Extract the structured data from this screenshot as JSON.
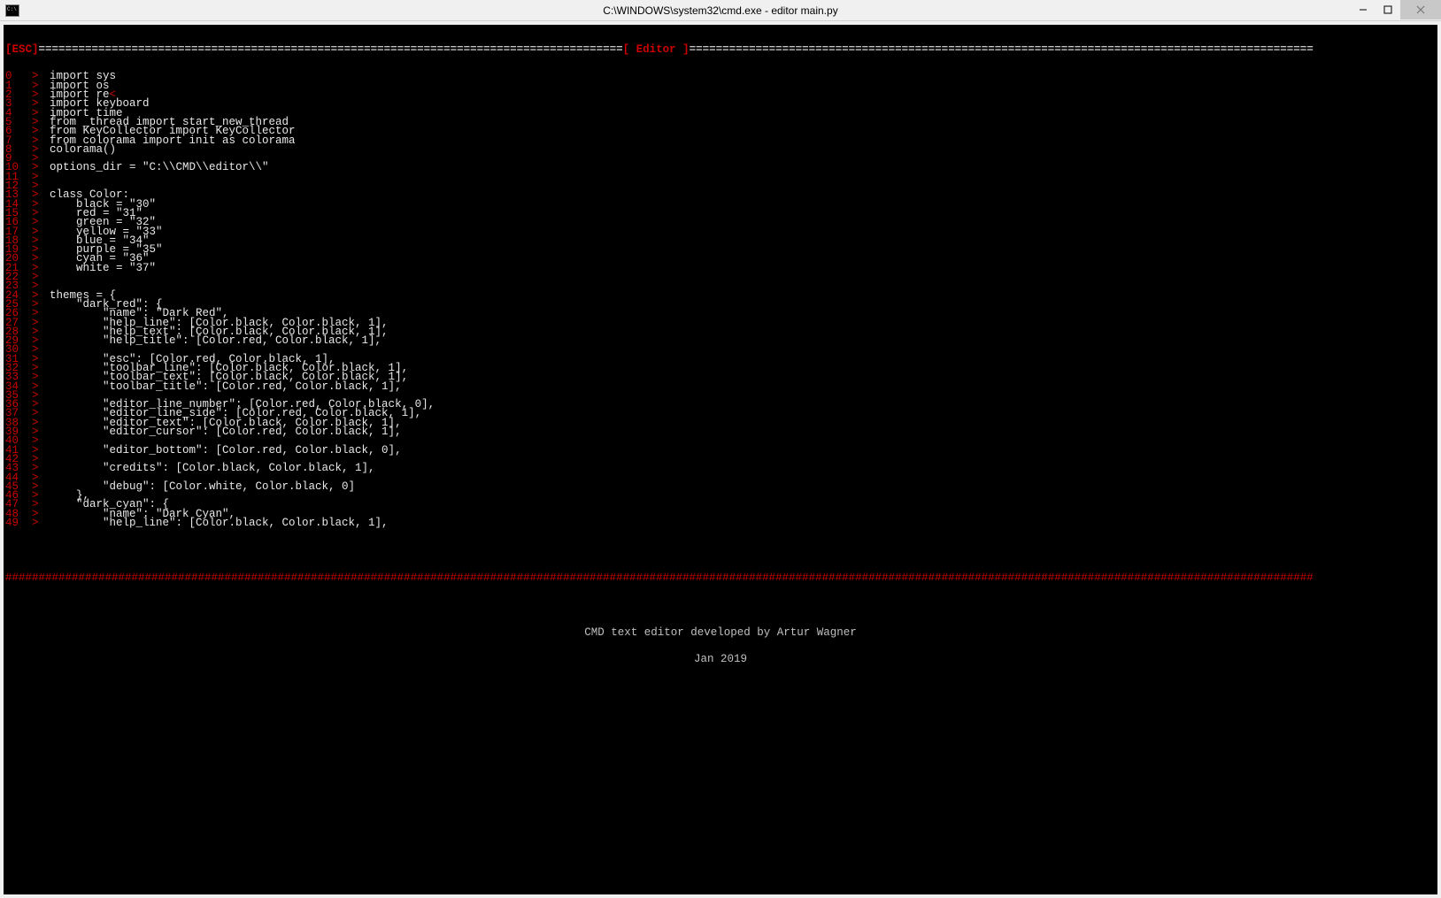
{
  "window": {
    "title": "C:\\WINDOWS\\system32\\cmd.exe - editor  main.py"
  },
  "toolbar": {
    "esc_label": "[ESC]",
    "title": "[ Editor ]",
    "fill": "="
  },
  "cursor_line": 2,
  "cursor_char": "<",
  "lines": [
    {
      "n": "0",
      "t": "import sys"
    },
    {
      "n": "1",
      "t": "import os"
    },
    {
      "n": "2",
      "t": "import re"
    },
    {
      "n": "3",
      "t": "import keyboard"
    },
    {
      "n": "4",
      "t": "import time"
    },
    {
      "n": "5",
      "t": "from _thread import start_new_thread"
    },
    {
      "n": "6",
      "t": "from KeyCollector import KeyCollector"
    },
    {
      "n": "7",
      "t": "from colorama import init as colorama"
    },
    {
      "n": "8",
      "t": "colorama()"
    },
    {
      "n": "9",
      "t": ""
    },
    {
      "n": "10",
      "t": "options_dir = \"C:\\\\CMD\\\\editor\\\\\""
    },
    {
      "n": "11",
      "t": ""
    },
    {
      "n": "12",
      "t": ""
    },
    {
      "n": "13",
      "t": "class Color:"
    },
    {
      "n": "14",
      "t": "    black = \"30\""
    },
    {
      "n": "15",
      "t": "    red = \"31\""
    },
    {
      "n": "16",
      "t": "    green = \"32\""
    },
    {
      "n": "17",
      "t": "    yellow = \"33\""
    },
    {
      "n": "18",
      "t": "    blue = \"34\""
    },
    {
      "n": "19",
      "t": "    purple = \"35\""
    },
    {
      "n": "20",
      "t": "    cyan = \"36\""
    },
    {
      "n": "21",
      "t": "    white = \"37\""
    },
    {
      "n": "22",
      "t": ""
    },
    {
      "n": "23",
      "t": ""
    },
    {
      "n": "24",
      "t": "themes = {"
    },
    {
      "n": "25",
      "t": "    \"dark_red\": {"
    },
    {
      "n": "26",
      "t": "        \"name\": \"Dark Red\","
    },
    {
      "n": "27",
      "t": "        \"help_line\": [Color.black, Color.black, 1],"
    },
    {
      "n": "28",
      "t": "        \"help_text\": [Color.black, Color.black, 1],"
    },
    {
      "n": "29",
      "t": "        \"help_title\": [Color.red, Color.black, 1],"
    },
    {
      "n": "30",
      "t": ""
    },
    {
      "n": "31",
      "t": "        \"esc\": [Color.red, Color.black, 1],"
    },
    {
      "n": "32",
      "t": "        \"toolbar_line\": [Color.black, Color.black, 1],"
    },
    {
      "n": "33",
      "t": "        \"toolbar_text\": [Color.black, Color.black, 1],"
    },
    {
      "n": "34",
      "t": "        \"toolbar_title\": [Color.red, Color.black, 1],"
    },
    {
      "n": "35",
      "t": ""
    },
    {
      "n": "36",
      "t": "        \"editor_line_number\": [Color.red, Color.black, 0],"
    },
    {
      "n": "37",
      "t": "        \"editor_line_side\": [Color.red, Color.black, 1],"
    },
    {
      "n": "38",
      "t": "        \"editor_text\": [Color.black, Color.black, 1],"
    },
    {
      "n": "39",
      "t": "        \"editor_cursor\": [Color.red, Color.black, 1],"
    },
    {
      "n": "40",
      "t": ""
    },
    {
      "n": "41",
      "t": "        \"editor_bottom\": [Color.red, Color.black, 0],"
    },
    {
      "n": "42",
      "t": ""
    },
    {
      "n": "43",
      "t": "        \"credits\": [Color.black, Color.black, 1],"
    },
    {
      "n": "44",
      "t": ""
    },
    {
      "n": "45",
      "t": "        \"debug\": [Color.white, Color.black, 0]"
    },
    {
      "n": "46",
      "t": "    },"
    },
    {
      "n": "47",
      "t": "    \"dark_cyan\": {"
    },
    {
      "n": "48",
      "t": "        \"name\": \"Dark Cyan\","
    },
    {
      "n": "49",
      "t": "        \"help_line\": [Color.black, Color.black, 1],"
    }
  ],
  "bottom_fill": "#",
  "credits": {
    "line1": "CMD text editor developed by Artur Wagner",
    "line2": "Jan 2019"
  }
}
